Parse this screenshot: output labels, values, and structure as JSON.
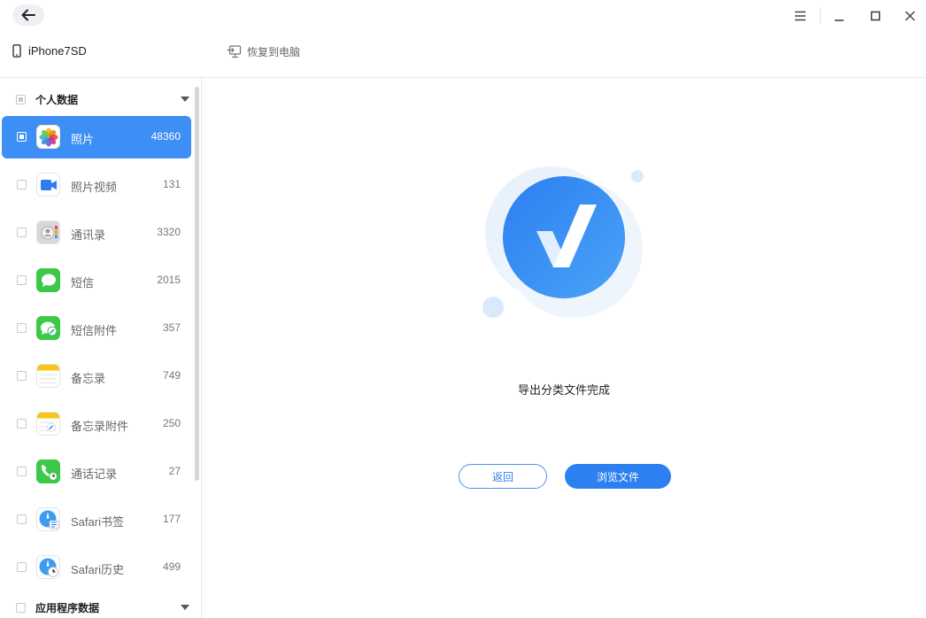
{
  "window": {
    "back_icon": "arrow-left-icon",
    "menu_icon": "hamburger-menu-icon",
    "minimize_icon": "minimize-icon",
    "maximize_icon": "maximize-icon",
    "close_icon": "close-icon"
  },
  "device": {
    "name": "iPhone7SD",
    "restore_label": "恢复到电脑"
  },
  "sidebar": {
    "personal_group": "个人数据",
    "app_group": "应用程序数据",
    "items": [
      {
        "name": "照片",
        "count": "48360",
        "icon": "photos-icon",
        "active": true
      },
      {
        "name": "照片视频",
        "count": "131",
        "icon": "video-camera-icon"
      },
      {
        "name": "通讯录",
        "count": "3320",
        "icon": "contacts-icon"
      },
      {
        "name": "短信",
        "count": "2015",
        "icon": "message-bubble-icon"
      },
      {
        "name": "短信附件",
        "count": "357",
        "icon": "message-attachment-icon"
      },
      {
        "name": "备忘录",
        "count": "749",
        "icon": "notes-icon"
      },
      {
        "name": "备忘录附件",
        "count": "250",
        "icon": "notes-attachment-icon"
      },
      {
        "name": "通话记录",
        "count": "27",
        "icon": "call-history-icon"
      },
      {
        "name": "Safari书签",
        "count": "177",
        "icon": "safari-bookmark-icon"
      },
      {
        "name": "Safari历史",
        "count": "499",
        "icon": "safari-history-icon"
      }
    ]
  },
  "main": {
    "message": "导出分类文件完成",
    "back_label": "返回",
    "browse_label": "浏览文件"
  },
  "colors": {
    "accent": "#2c80ef",
    "active_item": "#3d8ef5"
  }
}
